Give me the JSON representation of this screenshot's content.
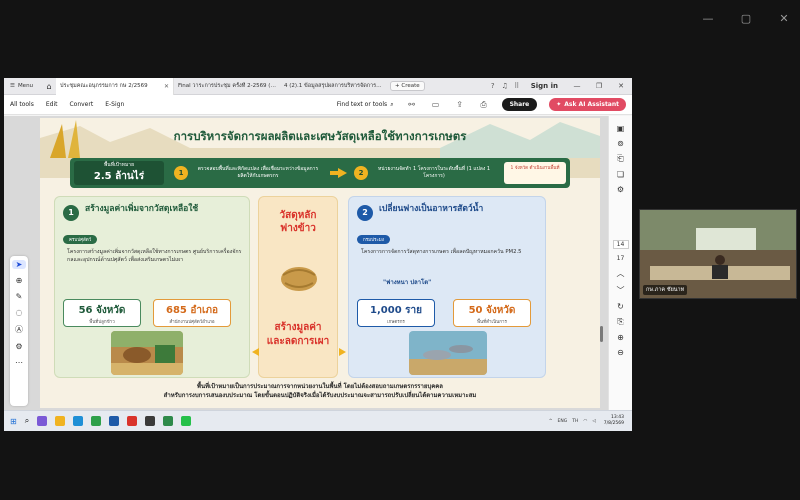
{
  "outer": {
    "controls": [
      "—",
      "▢",
      "✕"
    ]
  },
  "tabbar": {
    "menu_label": "Menu",
    "tabs": [
      {
        "title": "ประชุมคณะอนุกรรมการ กษ 2/2569",
        "active": true
      },
      {
        "title": "Final วาระการประชุม ครั้งที่ 2-2569 (เลื่อ...",
        "active": false
      },
      {
        "title": "4 (2).1 ข้อมูลสรุปผลการบริหารจัดการฯ...",
        "active": false
      }
    ],
    "new_tab": "+ Create",
    "signin": "Sign in"
  },
  "toolbar": {
    "items": [
      "All tools",
      "Edit",
      "Convert",
      "E-Sign"
    ],
    "find": "Find text or tools",
    "share": "Share",
    "ai": "Ask AI Assistant"
  },
  "infographic": {
    "title": "การบริหารจัดการผลผลิตและเศษวัสดุเหลือใช้ทางการเกษตร",
    "budget_label": "พื้นที่เป้าหมาย",
    "budget_value": "2.5 ล้านไร่",
    "step1_num": "1",
    "step1_text": "ตรวจสอบพื้นที่และพิกัดแปลง เพื่อเชื่อมระหว่างข้อมูลการผลิตให้กับเกษตรกร",
    "step2_num": "2",
    "step2_text": "หน่วยงานจัดทำ 1 โครงการในระดับพื้นที่ (1 แปลง 1 โครงการ)",
    "box_text": "1 จังหวัด ดำเนินงานพื้นที่",
    "left_card": {
      "num": "1",
      "heading": "สร้างมูลค่าเพิ่มจากวัสดุเหลือใช้",
      "pill": "ครบปศุสัตว์",
      "desc": "โครงการสร้างมูลค่าเพิ่มจากวัสดุเหลือใช้ทางการเกษตร ศูนย์บริการเครื่องจักรกลและอุปกรณ์ด้านปศุสัตว์ เพื่อส่งเสริมเกษตรไม่เผา",
      "stat1_big": "56 จังหวัด",
      "stat1_small": "พื้นที่ปลูกข้าว",
      "stat2_big": "685 อำเภอ",
      "stat2_small": "สำนักงานปศุสัตว์อำเภอ"
    },
    "center": {
      "line1": "วัสดุหลัก",
      "line2": "ฟางข้าว",
      "line3": "สร้างมูลค่า",
      "line4": "และลดการเผา"
    },
    "right_card": {
      "num": "2",
      "heading": "เปลี่ยนฟางเป็นอาหารสัตว์น้ำ",
      "pill": "กรมประมง",
      "desc": "โครงการการจัดการวัสดุทางการเกษตร เพื่อลดปัญหาหมอกควัน PM2.5",
      "quote": "\"ฟางหนา ปลาโต\"",
      "stat1_big": "1,000 ราย",
      "stat1_small": "เกษตรกร",
      "stat2_big": "50 จังหวัด",
      "stat2_small": "พื้นที่ดำเนินการ"
    },
    "footer1": "พื้นที่เป้าหมายเป็นการประมาณการจากหน่วยงานในพื้นที่ โดยไม่ต้องสอบถามเกษตรกรรายบุคคล",
    "footer2": "สำหรับการงบการเสนองบประมาณ โดยขั้นตอนปฏิบัติจริงเมื่อได้รับงบประมาณจะสามารถปรับเปลี่ยนได้ตามความเหมาะสม"
  },
  "right_tools": {
    "page": "14",
    "total": "17"
  },
  "taskbar": {
    "tray": [
      "ENG",
      "TH"
    ],
    "time": "13:43",
    "date": "7/8/2569"
  },
  "video": {
    "name": "กษ.ภาค ชัยนาท"
  }
}
